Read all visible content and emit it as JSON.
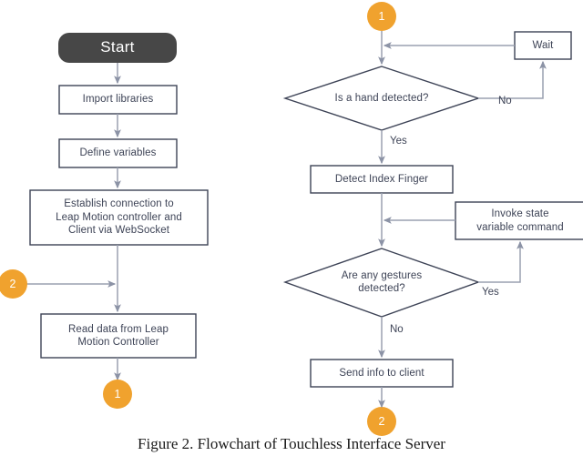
{
  "figure": {
    "caption": "Figure 2. Flowchart of Touchless Interface Server"
  },
  "colors": {
    "start_fill": "#474747",
    "start_text": "#ffffff",
    "box_stroke": "#3d4356",
    "box_fill": "#ffffff",
    "box_text": "#3d4356",
    "arrow": "#9aa0b0",
    "connector_fill": "#f0a22e",
    "connector_text": "#ffffff",
    "background": "#ffffff"
  },
  "left_column": {
    "start": {
      "label": "Start"
    },
    "import_libraries": {
      "label": "Import libraries"
    },
    "define_variables": {
      "label": "Define variables"
    },
    "establish_connection": {
      "label": "Establish connection to\nLeap Motion controller and\nClient via WebSocket"
    },
    "read_data": {
      "label": "Read data from Leap\nMotion Controller"
    },
    "connector_in": {
      "label": "2"
    },
    "connector_out": {
      "label": "1"
    }
  },
  "right_column": {
    "connector_in": {
      "label": "1"
    },
    "wait": {
      "label": "Wait"
    },
    "hand_decision": {
      "label": "Is a hand detected?"
    },
    "hand_decision_no": {
      "label": "No"
    },
    "hand_decision_yes": {
      "label": "Yes"
    },
    "detect_index_finger": {
      "label": "Detect Index Finger"
    },
    "invoke_state": {
      "label": "Invoke state\nvariable command"
    },
    "gesture_decision": {
      "label": "Are any gestures\ndetected?"
    },
    "gesture_decision_yes": {
      "label": "Yes"
    },
    "gesture_decision_no": {
      "label": "No"
    },
    "send_info": {
      "label": "Send info to client"
    },
    "connector_out": {
      "label": "2"
    }
  }
}
